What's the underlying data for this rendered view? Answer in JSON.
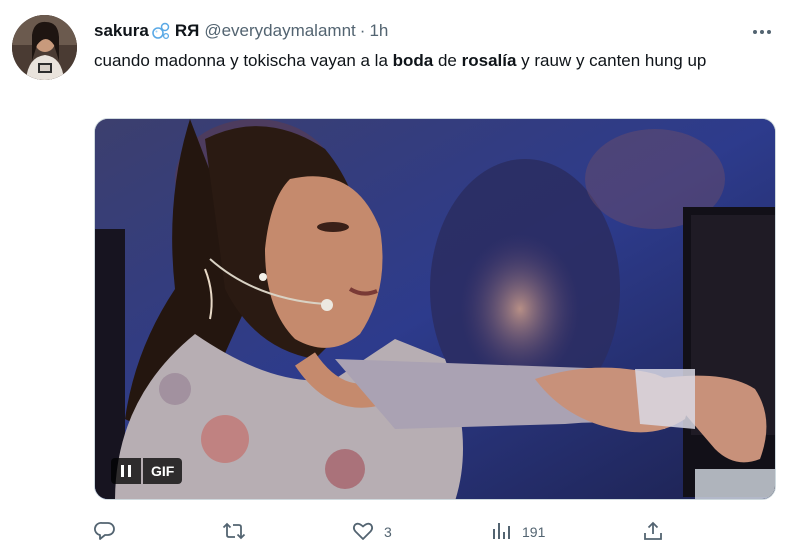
{
  "author": {
    "display_name": "sakura",
    "name_emoji_icon": "bubbles-icon",
    "name_tag": "RЯ",
    "handle": "@everydaymalamnt",
    "separator": "·",
    "time": "1h"
  },
  "tweet": {
    "text_segments": [
      {
        "text": "cuando madonna y tokischa vayan a la ",
        "bold": false
      },
      {
        "text": "boda",
        "bold": true
      },
      {
        "text": " de ",
        "bold": false
      },
      {
        "text": "rosalía",
        "bold": true
      },
      {
        "text": " y rauw y canten hung up",
        "bold": false
      }
    ]
  },
  "media": {
    "type": "gif",
    "badge_label": "GIF",
    "pause_icon": "pause-icon"
  },
  "actions": {
    "reply": {
      "icon": "reply-icon",
      "count": ""
    },
    "retweet": {
      "icon": "retweet-icon",
      "count": ""
    },
    "like": {
      "icon": "heart-icon",
      "count": "3"
    },
    "views": {
      "icon": "views-icon",
      "count": "191"
    },
    "share": {
      "icon": "share-icon"
    }
  },
  "colors": {
    "text_primary": "#0f1419",
    "text_secondary": "#536471",
    "border": "#cfd9de",
    "bubble_accent": "#5aa9e6"
  }
}
